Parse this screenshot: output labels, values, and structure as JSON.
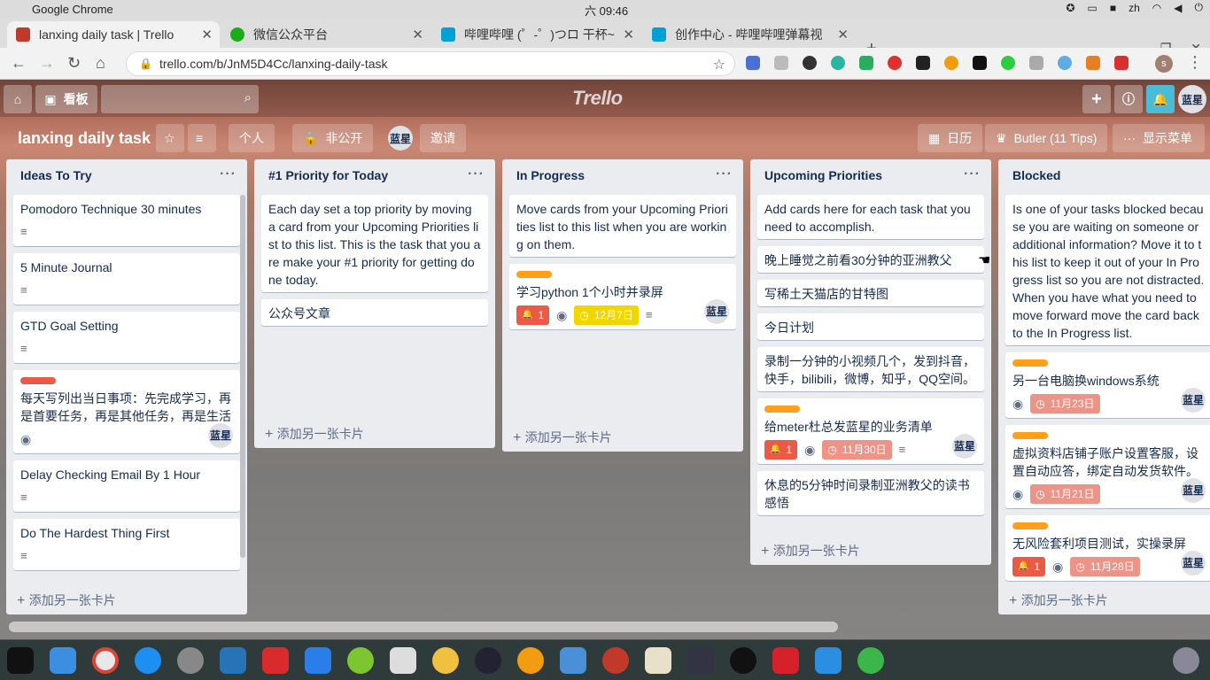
{
  "os": {
    "app_name": "Google Chrome",
    "clock": "六 09:46",
    "lang": "zh"
  },
  "browser": {
    "tabs": [
      {
        "title": "lanxing daily task | Trello",
        "favicon_color": "#0079bf"
      },
      {
        "title": "微信公众平台",
        "favicon_color": "#1aad19"
      },
      {
        "title": "哔哩哔哩 (゜-゜)つロ 干杯~",
        "favicon_color": "#00a1d6"
      },
      {
        "title": "创作中心 - 哔哩哔哩弹幕视",
        "favicon_color": "#00a1d6"
      }
    ],
    "new_tab": "+",
    "url": "trello.com/b/JnM5D4Cc/lanxing-daily-task",
    "profile": "s"
  },
  "header": {
    "boards_label": "看板",
    "logo": "Trello",
    "avatar": "蓝星"
  },
  "board": {
    "title": "lanxing daily task",
    "team": "个人",
    "visibility": "非公开",
    "invite": "邀请",
    "member": "蓝星",
    "calendar": "日历",
    "butler": "Butler (11 Tips)",
    "menu": "显示菜单"
  },
  "add_card": "添加另一张卡片",
  "lists": [
    {
      "name": "Ideas To Try",
      "cards": [
        {
          "text": "Pomodoro Technique 30 minutes",
          "desc": true
        },
        {
          "text": "5 Minute Journal",
          "desc": true
        },
        {
          "text": "GTD Goal Setting",
          "desc": true
        },
        {
          "text": "每天写列出当日事项：先完成学习，再是首要任务，再是其他任务，再是生活",
          "label": "#eb5a46",
          "watch": true,
          "member": "蓝星"
        },
        {
          "text": "Delay Checking Email By 1 Hour",
          "desc": true
        },
        {
          "text": "Do The Hardest Thing First",
          "desc": true
        }
      ]
    },
    {
      "name": "#1 Priority for Today",
      "cards": [
        {
          "text": "Each day set a top priority by moving a card from your Upcoming Priorities list to this list. This is the task that you are make your #1 priority for getting done today."
        },
        {
          "text": "公众号文章"
        }
      ]
    },
    {
      "name": "In Progress",
      "cards": [
        {
          "text": "Move cards from your Upcoming Priorities list to this list when you are working on them."
        },
        {
          "text": "学习python 1个小时并录屏",
          "label": "#ff9f1a",
          "notif": "1",
          "watch": true,
          "due": "12月7日",
          "due_color": "#f2d600",
          "desc": true,
          "member": "蓝星"
        }
      ]
    },
    {
      "name": "Upcoming Priorities",
      "cards": [
        {
          "text": "Add cards here for each task that you need to accomplish."
        },
        {
          "text": "晚上睡觉之前看30分钟的亚洲教父"
        },
        {
          "text": "写稀土天猫店的甘特图"
        },
        {
          "text": "今日计划"
        },
        {
          "text": "录制一分钟的小视频几个，发到抖音，快手，bilibili，微博，知乎，QQ空间。"
        },
        {
          "text": "给meter杜总发蓝星的业务清单",
          "label": "#ff9f1a",
          "notif": "1",
          "watch": true,
          "due": "11月30日",
          "due_color": "#ec9488",
          "desc": true,
          "member": "蓝星"
        },
        {
          "text": "休息的5分钟时间录制亚洲教父的读书感悟"
        }
      ]
    },
    {
      "name": "Blocked",
      "cards": [
        {
          "text": "Is one of your tasks blocked because you are waiting on someone or additional information? Move it to this list to keep it out of your In Progress list so you are not distracted. When you have what you need to move forward move the card back to the In Progress list."
        },
        {
          "text": "另一台电脑换windows系统",
          "label": "#ff9f1a",
          "watch": true,
          "due": "11月23日",
          "due_color": "#ec9488",
          "member": "蓝星"
        },
        {
          "text": "虚拟资料店铺子账户设置客服，设置自动应答，绑定自动发货软件。",
          "label": "#ff9f1a",
          "watch": true,
          "due": "11月21日",
          "due_color": "#ec9488",
          "member": "蓝星"
        },
        {
          "text": "无风险套利项目测试，实操录屏",
          "label": "#ff9f1a",
          "notif": "1",
          "watch": true,
          "due": "11月28日",
          "due_color": "#ec9488",
          "member": "蓝星"
        }
      ]
    }
  ]
}
